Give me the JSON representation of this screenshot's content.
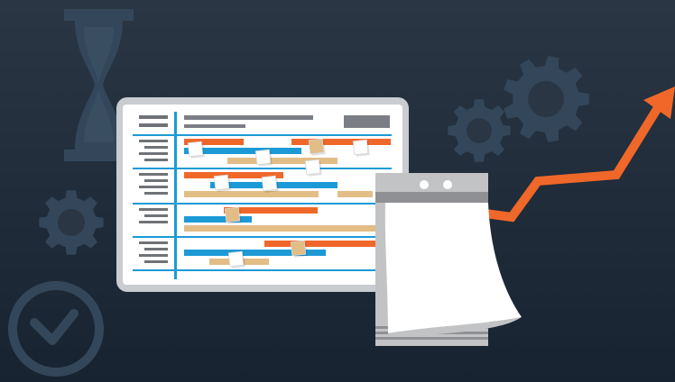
{
  "palette": {
    "background_top": "#2a3644",
    "background_bottom": "#172330",
    "decor": "#34475a",
    "decor_dark": "#3a4e62",
    "board_frame": "#c9ccd0",
    "board_surface": "#ffffff",
    "grid_blue": "#1c9ad6",
    "bar_orange": "#f0672a",
    "bar_blue": "#1c9ad6",
    "bar_tan": "#e2bd86",
    "header_gray": "#7b7f85",
    "label_gray": "#6f7378",
    "note_white": "#ffffff",
    "note_tan": "#e2bd86",
    "trend_orange": "#f0672a",
    "calendar_gray": "#c2c3c5",
    "calendar_dark": "#8e9094",
    "calendar_page": "#ffffff"
  },
  "decorations": {
    "icons": [
      "hourglass-icon",
      "gear-icon",
      "gear-icon",
      "gear-icon",
      "clock-icon"
    ]
  },
  "board": {
    "icon": "gantt-chart-icon",
    "rows": [
      {
        "label_lines": 4,
        "bars": [
          "orange",
          "orange",
          "blue",
          "tan"
        ],
        "notes": [
          "white",
          "white",
          "tan",
          "white",
          "white"
        ]
      },
      {
        "label_lines": 4,
        "bars": [
          "orange",
          "blue",
          "tan",
          "tan"
        ],
        "notes": [
          "white",
          "white"
        ]
      },
      {
        "label_lines": 3,
        "bars": [
          "orange",
          "blue",
          "tan"
        ],
        "notes": [
          "tan"
        ]
      },
      {
        "label_lines": 4,
        "bars": [
          "orange",
          "blue",
          "tan"
        ],
        "notes": [
          "tan",
          "white"
        ]
      }
    ]
  },
  "trend_line": {
    "icon": "trend-arrow-icon",
    "direction": "up"
  },
  "calendar": {
    "icon": "tear-off-calendar-icon",
    "rings": 2,
    "page_state": "curling"
  }
}
